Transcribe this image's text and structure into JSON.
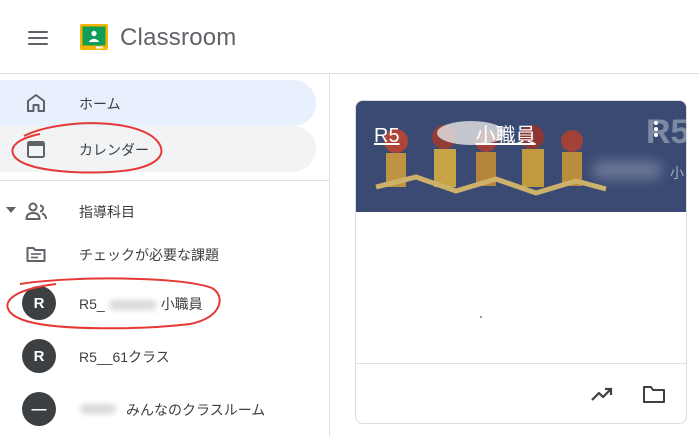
{
  "header": {
    "app_title": "Classroom"
  },
  "sidebar": {
    "items": [
      {
        "label": "ホーム",
        "icon": "home-icon",
        "state": "active"
      },
      {
        "label": "カレンダー",
        "icon": "calendar-icon",
        "state": "hover"
      },
      {
        "label": "指導科目",
        "icon": "people-icon",
        "expanded": true
      },
      {
        "label": "チェックが必要な課題",
        "icon": "todo-folder-icon"
      }
    ],
    "classes": [
      {
        "avatar": "R",
        "prefix": "R5_",
        "suffix": "小職員"
      },
      {
        "avatar": "R",
        "name": "R5__61クラス"
      },
      {
        "avatar": "—",
        "name": "みんなのクラスルーム"
      }
    ]
  },
  "card": {
    "title_prefix": "R5",
    "title_suffix": "小職員",
    "watermark": "R5",
    "watermark_small": "小"
  },
  "colors": {
    "active_bg": "#e8f0fe",
    "hover_bg": "#f1f3f4",
    "banner_bg": "#3a4a73",
    "annotation_red": "#e53935",
    "logo_green": "#0f9d58",
    "logo_yellow": "#f4b400"
  }
}
